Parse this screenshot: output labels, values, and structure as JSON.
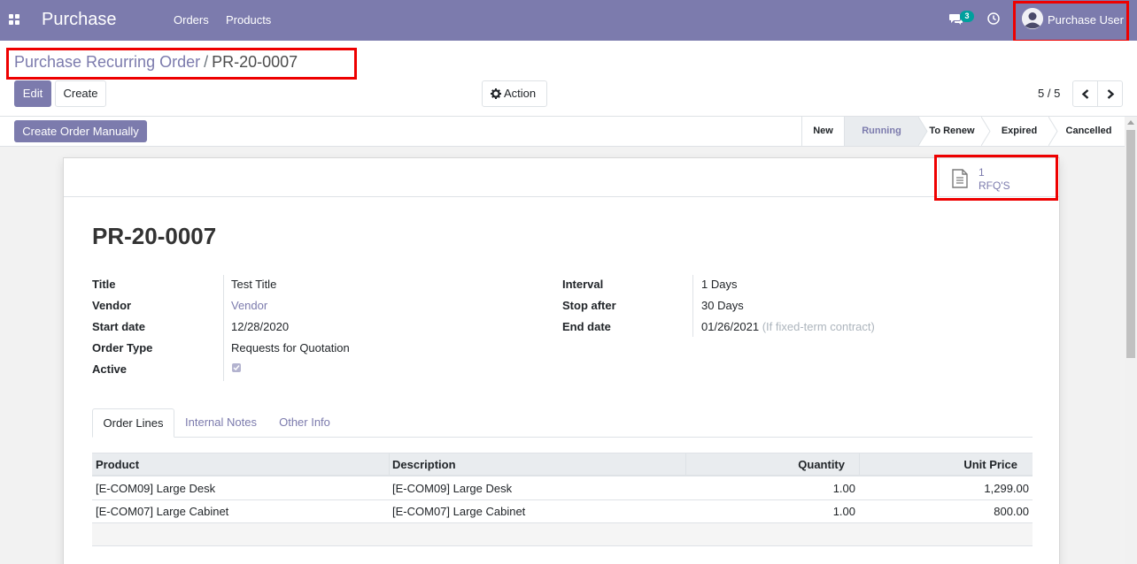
{
  "navbar": {
    "brand": "Purchase",
    "menu": [
      "Orders",
      "Products"
    ],
    "chat_badge": "3",
    "user": "Purchase User"
  },
  "breadcrumb": {
    "parent": "Purchase Recurring Order",
    "separator": "/",
    "current": "PR-20-0007"
  },
  "toolbar": {
    "edit_label": "Edit",
    "create_label": "Create",
    "action_label": "Action",
    "pager": "5 / 5"
  },
  "statusbar": {
    "manual_button": "Create Order Manually",
    "stages": [
      "New",
      "Running",
      "To Renew",
      "Expired",
      "Cancelled"
    ],
    "active_stage": "Running"
  },
  "smart_button": {
    "count": "1",
    "label": "RFQ'S"
  },
  "record": {
    "name": "PR-20-0007",
    "left_fields": [
      {
        "label": "Title",
        "value": "Test Title"
      },
      {
        "label": "Vendor",
        "value": "Vendor"
      },
      {
        "label": "Start date",
        "value": "12/28/2020"
      },
      {
        "label": "Order Type",
        "value": "Requests for Quotation"
      },
      {
        "label": "Active",
        "value": ""
      }
    ],
    "active_checked": true,
    "right_fields": [
      {
        "label": "Interval",
        "value": "1",
        "unit": "Days"
      },
      {
        "label": "Stop after",
        "value": "30",
        "unit": "Days"
      },
      {
        "label": "End date",
        "value": "01/26/2021",
        "hint": "(If fixed-term contract)"
      }
    ]
  },
  "tabs": [
    "Order Lines",
    "Internal Notes",
    "Other Info"
  ],
  "active_tab": "Order Lines",
  "order_lines": {
    "columns": [
      "Product",
      "Description",
      "Quantity",
      "Unit Price"
    ],
    "rows": [
      [
        "[E-COM09] Large Desk",
        "[E-COM09] Large Desk",
        "1.00",
        "1,299.00"
      ],
      [
        "[E-COM07] Large Cabinet",
        "[E-COM07] Large Cabinet",
        "1.00",
        "800.00"
      ]
    ]
  },
  "colors": {
    "brand": "#7c7bad",
    "highlight": "#ee0000"
  }
}
